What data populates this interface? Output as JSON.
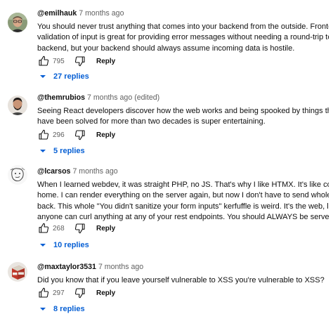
{
  "comments": [
    {
      "author": "@emilhauk",
      "time": "7 months ago",
      "edited": "",
      "body": [
        "You should never trust anything that comes into your backend from the outside. Frontend",
        "validation of input is great for providing error messages without needing a round-trip to the",
        "backend, but your backend should always assume incoming data is hostile."
      ],
      "likes": "795",
      "reply_label": "Reply",
      "replies_label": "27 replies",
      "avatar_icon": "avatar-man-glasses",
      "avatar_color": "#7a8a6a"
    },
    {
      "author": "@themrubios",
      "time": "7 months ago",
      "edited": "(edited)",
      "body": [
        "Seeing React developers discover how the web works and being spooked by things that",
        "have been solved for more than two decades is super entertaining."
      ],
      "likes": "296",
      "reply_label": "Reply",
      "replies_label": "5 replies",
      "avatar_icon": "avatar-man-beard",
      "avatar_color": "#3b3b3b"
    },
    {
      "author": "@lcarsos",
      "time": "7 months ago",
      "edited": "",
      "body": [
        "When I learned webdev, it was straight PHP, no JS. That's why I like HTMX. It's like coming",
        "home. I can render everything on the server again, but now I don't have to send whole pages",
        "back. This whole \"You didn't sanitize your form inputs\" kerfuffle is weird. It's the web, literally",
        "anyone can curl anything at any of your rest endpoints. You should ALWAYS be server-side .."
      ],
      "likes": "268",
      "reply_label": "Reply",
      "replies_label": "10 replies",
      "avatar_icon": "avatar-sketch-face",
      "avatar_color": "#f4f4f4"
    },
    {
      "author": "@maxtaylor3531",
      "time": "7 months ago",
      "edited": "",
      "body": [
        "Did you know that if you leave yourself vulnerable to XSS you're vulnerable to XSS?"
      ],
      "likes": "297",
      "reply_label": "Reply",
      "replies_label": "8 replies",
      "avatar_icon": "avatar-tnt-block",
      "avatar_color": "#c0392b"
    }
  ],
  "colors": {
    "link_blue": "#065fd4",
    "meta_gray": "#606060",
    "text": "#0f0f0f"
  }
}
